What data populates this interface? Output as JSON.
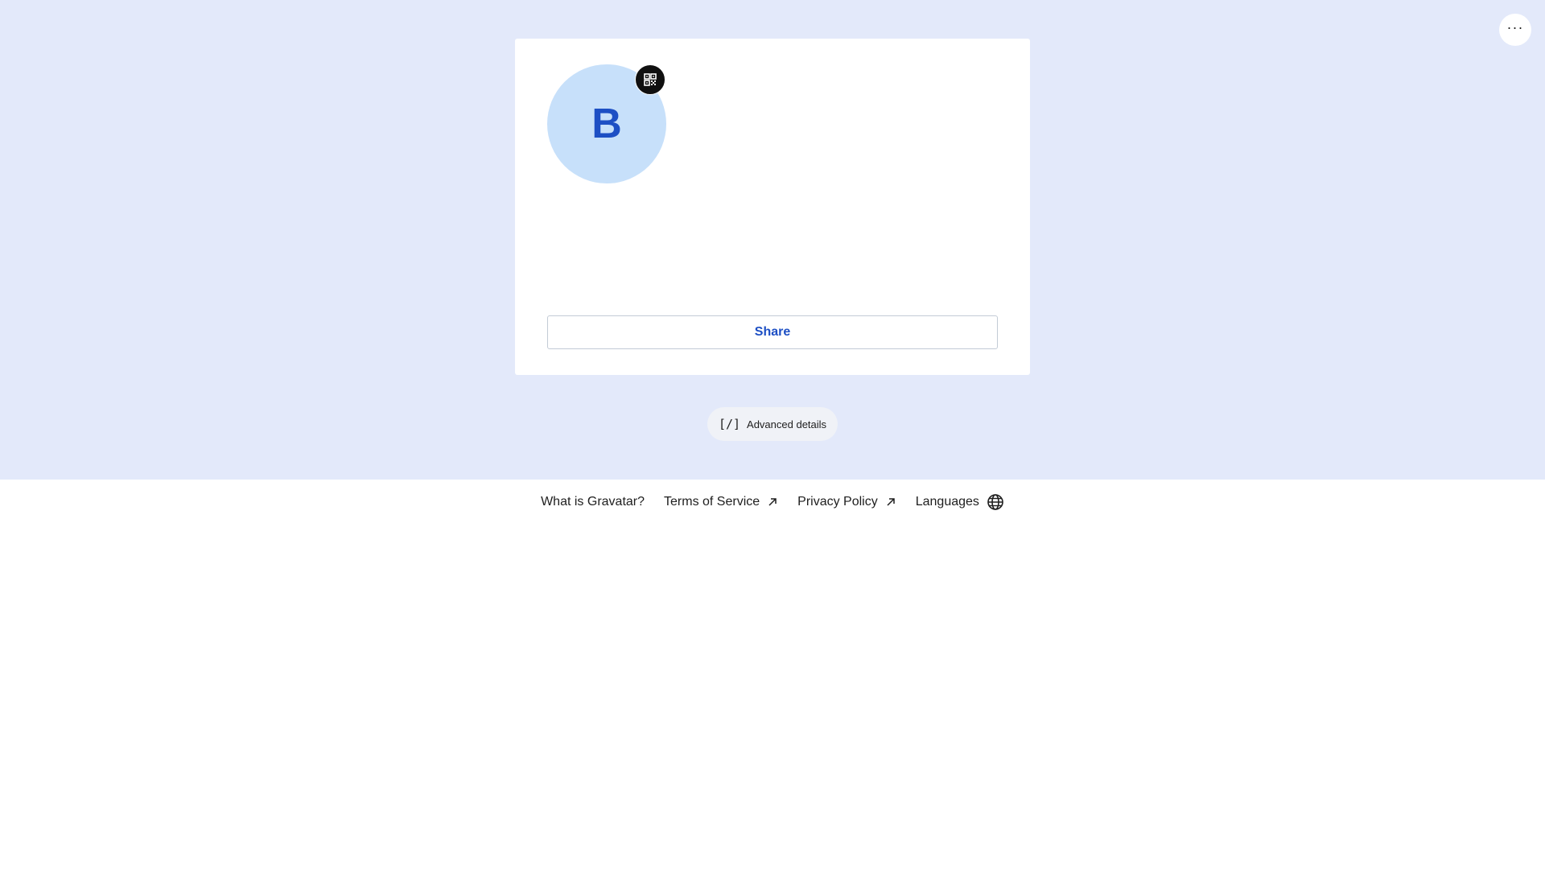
{
  "header": {
    "more_icon": "more-horizontal-icon",
    "more_label": "···"
  },
  "profile": {
    "avatar_initial": "B",
    "qr_icon": "qr-code-icon",
    "share_label": "Share"
  },
  "advanced": {
    "icon_text": "[/]",
    "label": "Advanced details"
  },
  "footer": {
    "links": [
      {
        "label": "What is Gravatar?",
        "icon": ""
      },
      {
        "label": "Terms of Service",
        "icon": "external-arrow-icon"
      },
      {
        "label": "Privacy Policy",
        "icon": "external-arrow-icon"
      },
      {
        "label": "Languages",
        "icon": "globe-icon"
      }
    ]
  },
  "colors": {
    "hero_bg": "#e3e9fa",
    "avatar_bg": "#c7e0fa",
    "accent": "#1d4fc4"
  }
}
